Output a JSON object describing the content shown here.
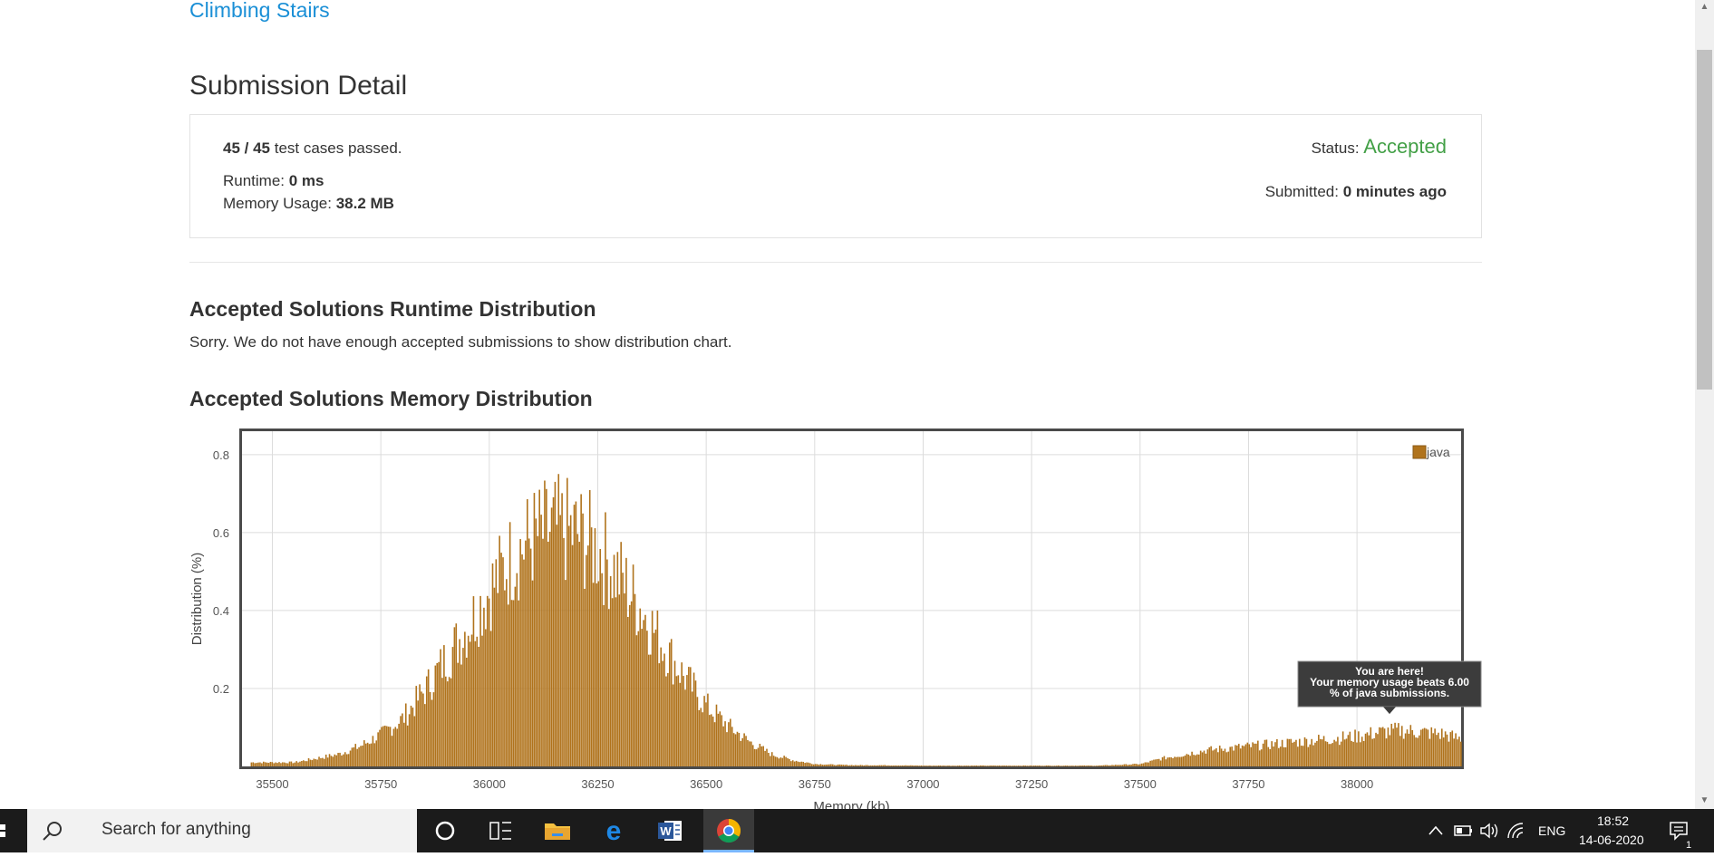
{
  "problem": {
    "title": "Climbing Stairs"
  },
  "submission": {
    "heading": "Submission Detail",
    "cases_passed": "45 / 45",
    "cases_suffix": " test cases passed.",
    "runtime_label": "Runtime: ",
    "runtime_value": "0 ms",
    "memory_label": "Memory Usage: ",
    "memory_value": "38.2 MB",
    "status_label": "Status: ",
    "status_value": "Accepted",
    "submitted_label": "Submitted: ",
    "submitted_value": "0 minutes ago",
    "accepted_color": "#43a047"
  },
  "runtime_distribution": {
    "title": "Accepted Solutions Runtime Distribution",
    "message": "Sorry. We do not have enough accepted submissions to show distribution chart."
  },
  "memory_distribution": {
    "title": "Accepted Solutions Memory Distribution",
    "tooltip_line1": "You are here!",
    "tooltip_line2": "Your memory usage beats 6.00",
    "tooltip_line3": "% of java submissions."
  },
  "chart_data": {
    "type": "bar",
    "xlabel": "Memory (kb)",
    "ylabel": "Distribution (%)",
    "xlim": [
      35430,
      38240
    ],
    "ylim": [
      0,
      0.86
    ],
    "x_ticks": [
      "35500",
      "35750",
      "36000",
      "36250",
      "36500",
      "36750",
      "37000",
      "37250",
      "37500",
      "37750",
      "38000"
    ],
    "y_ticks": [
      "0.2",
      "0.4",
      "0.6",
      "0.8"
    ],
    "grid": true,
    "legend_position": "top-right",
    "series": [
      {
        "name": "java",
        "color": "#b0731c",
        "points": [
          [
            35450,
            0.01
          ],
          [
            35500,
            0.01
          ],
          [
            35550,
            0.01
          ],
          [
            35600,
            0.02
          ],
          [
            35650,
            0.03
          ],
          [
            35700,
            0.05
          ],
          [
            35750,
            0.08
          ],
          [
            35800,
            0.12
          ],
          [
            35850,
            0.19
          ],
          [
            35900,
            0.27
          ],
          [
            35950,
            0.35
          ],
          [
            36000,
            0.44
          ],
          [
            36050,
            0.52
          ],
          [
            36100,
            0.57
          ],
          [
            36150,
            0.59
          ],
          [
            36200,
            0.58
          ],
          [
            36250,
            0.54
          ],
          [
            36300,
            0.47
          ],
          [
            36350,
            0.39
          ],
          [
            36400,
            0.3
          ],
          [
            36450,
            0.22
          ],
          [
            36500,
            0.15
          ],
          [
            36550,
            0.1
          ],
          [
            36600,
            0.06
          ],
          [
            36650,
            0.03
          ],
          [
            36700,
            0.015
          ],
          [
            36750,
            0.006
          ],
          [
            36800,
            0.004
          ],
          [
            36850,
            0.003
          ],
          [
            36900,
            0.003
          ],
          [
            37000,
            0.002
          ],
          [
            37100,
            0.002
          ],
          [
            37250,
            0.002
          ],
          [
            37400,
            0.002
          ],
          [
            37500,
            0.006
          ],
          [
            37550,
            0.02
          ],
          [
            37600,
            0.03
          ],
          [
            37650,
            0.04
          ],
          [
            37700,
            0.045
          ],
          [
            37750,
            0.05
          ],
          [
            37800,
            0.055
          ],
          [
            37850,
            0.06
          ],
          [
            37900,
            0.065
          ],
          [
            37950,
            0.07
          ],
          [
            38000,
            0.075
          ],
          [
            38050,
            0.085
          ],
          [
            38100,
            0.09
          ],
          [
            38150,
            0.085
          ],
          [
            38200,
            0.08
          ],
          [
            38230,
            0.07
          ]
        ]
      }
    ],
    "marker": {
      "x": 38075,
      "y": 0.13
    }
  },
  "taskbar": {
    "search_placeholder": "Search for anything",
    "language": "ENG",
    "time": "18:52",
    "date": "14-06-2020",
    "notification_count": "1"
  }
}
